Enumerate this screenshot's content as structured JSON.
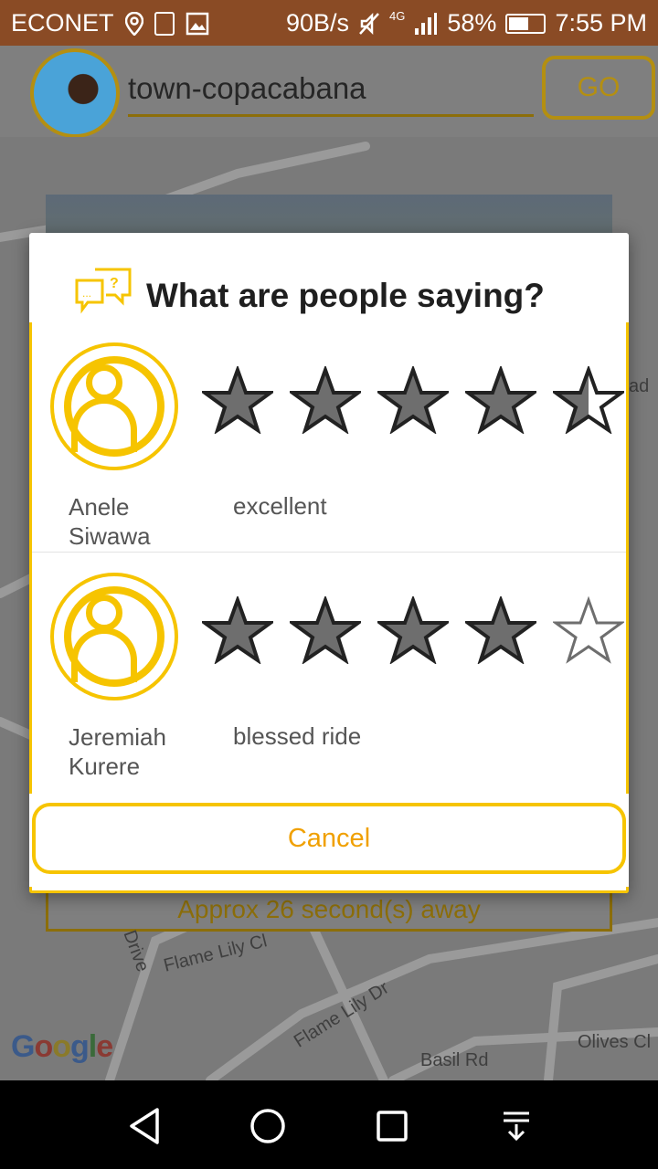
{
  "status_bar": {
    "carrier": "ECONET",
    "speed": "90B/s",
    "network": "4G",
    "battery": "58%",
    "battery_level": 0.58,
    "time": "7:55 PM"
  },
  "header": {
    "search_value": "town-copacabana",
    "go_label": "GO"
  },
  "map": {
    "labels": [
      "Flame Lily Cl",
      "Flame Lily Dr",
      "Basil Rd",
      "Olives Cl",
      "Drive",
      "ad"
    ],
    "google": "Google"
  },
  "eta": "Approx 26 second(s) away",
  "dialog": {
    "title": "What are people saying?",
    "reviews": [
      {
        "name": "Anele Siwawa",
        "comment": "excellent",
        "rating": 4.5
      },
      {
        "name": "Jeremiah Kurere",
        "comment": "blessed ride",
        "rating": 4
      }
    ],
    "cancel_label": "Cancel"
  },
  "colors": {
    "accent": "#f6c400",
    "cancel_text": "#f0a000",
    "status_bar": "#8a4b25"
  }
}
